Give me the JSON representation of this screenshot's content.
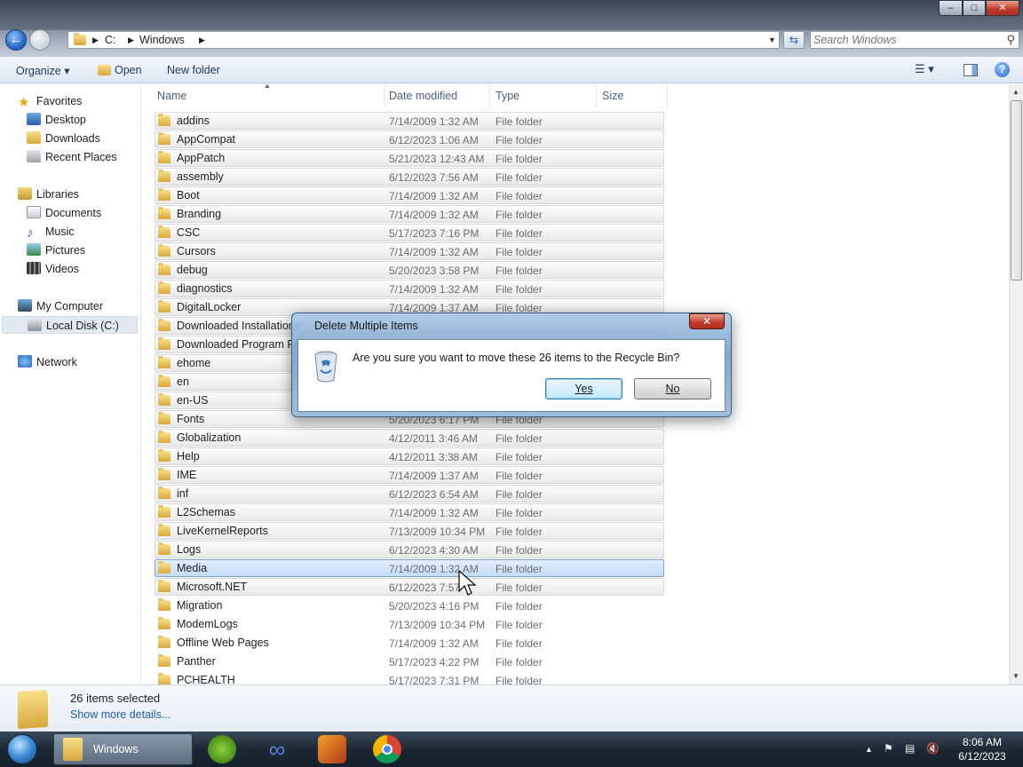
{
  "window": {
    "min_label": "–",
    "max_label": "□",
    "close_label": "✕"
  },
  "address": {
    "crumbs": [
      "C:",
      "Windows"
    ],
    "search_placeholder": "Search Windows"
  },
  "toolbar": {
    "organize": "Organize ▾",
    "open": "Open",
    "new_folder": "New folder"
  },
  "nav": {
    "favorites": "Favorites",
    "desktop": "Desktop",
    "downloads": "Downloads",
    "recent_places": "Recent Places",
    "libraries": "Libraries",
    "documents": "Documents",
    "music": "Music",
    "pictures": "Pictures",
    "videos": "Videos",
    "my_computer": "My Computer",
    "local_disk": "Local Disk (C:)",
    "network": "Network"
  },
  "columns": {
    "name": "Name",
    "date": "Date modified",
    "type": "Type",
    "size": "Size"
  },
  "rows": [
    {
      "name": "addins",
      "date": "7/14/2009 1:32 AM",
      "type": "File folder"
    },
    {
      "name": "AppCompat",
      "date": "6/12/2023 1:06 AM",
      "type": "File folder"
    },
    {
      "name": "AppPatch",
      "date": "5/21/2023 12:43 AM",
      "type": "File folder"
    },
    {
      "name": "assembly",
      "date": "6/12/2023 7:56 AM",
      "type": "File folder"
    },
    {
      "name": "Boot",
      "date": "7/14/2009 1:32 AM",
      "type": "File folder"
    },
    {
      "name": "Branding",
      "date": "7/14/2009 1:32 AM",
      "type": "File folder"
    },
    {
      "name": "CSC",
      "date": "5/17/2023 7:16 PM",
      "type": "File folder"
    },
    {
      "name": "Cursors",
      "date": "7/14/2009 1:32 AM",
      "type": "File folder"
    },
    {
      "name": "debug",
      "date": "5/20/2023 3:58 PM",
      "type": "File folder"
    },
    {
      "name": "diagnostics",
      "date": "7/14/2009 1:32 AM",
      "type": "File folder"
    },
    {
      "name": "DigitalLocker",
      "date": "7/14/2009 1:37 AM",
      "type": "File folder"
    },
    {
      "name": "Downloaded Installations",
      "date": "",
      "type": ""
    },
    {
      "name": "Downloaded Program Files",
      "date": "",
      "type": ""
    },
    {
      "name": "ehome",
      "date": "",
      "type": ""
    },
    {
      "name": "en",
      "date": "",
      "type": ""
    },
    {
      "name": "en-US",
      "date": "",
      "type": ""
    },
    {
      "name": "Fonts",
      "date": "5/20/2023 6:17 PM",
      "type": "File folder"
    },
    {
      "name": "Globalization",
      "date": "4/12/2011 3:46 AM",
      "type": "File folder"
    },
    {
      "name": "Help",
      "date": "4/12/2011 3:38 AM",
      "type": "File folder"
    },
    {
      "name": "IME",
      "date": "7/14/2009 1:37 AM",
      "type": "File folder"
    },
    {
      "name": "inf",
      "date": "6/12/2023 6:54 AM",
      "type": "File folder"
    },
    {
      "name": "L2Schemas",
      "date": "7/14/2009 1:32 AM",
      "type": "File folder"
    },
    {
      "name": "LiveKernelReports",
      "date": "7/13/2009 10:34 PM",
      "type": "File folder"
    },
    {
      "name": "Logs",
      "date": "6/12/2023 4:30 AM",
      "type": "File folder"
    },
    {
      "name": "Media",
      "date": "7/14/2009 1:32 AM",
      "type": "File folder"
    },
    {
      "name": "Microsoft.NET",
      "date": "6/12/2023 7:57",
      "type": "File folder"
    },
    {
      "name": "Migration",
      "date": "5/20/2023 4:16 PM",
      "type": "File folder"
    },
    {
      "name": "ModemLogs",
      "date": "7/13/2009 10:34 PM",
      "type": "File folder"
    },
    {
      "name": "Offline Web Pages",
      "date": "7/14/2009 1:32 AM",
      "type": "File folder"
    },
    {
      "name": "Panther",
      "date": "5/17/2023 4:22 PM",
      "type": "File folder"
    },
    {
      "name": "PCHEALTH",
      "date": "5/17/2023 7:31 PM",
      "type": "File folder"
    }
  ],
  "details": {
    "selected": "26 items selected",
    "more": "Show more details..."
  },
  "dialog": {
    "title": "Delete Multiple Items",
    "close": "✕",
    "message": "Are you sure you want to move these 26 items to the Recycle Bin?",
    "yes": "Yes",
    "no": "No"
  },
  "taskbar": {
    "explorer_label": "Windows",
    "time": "8:06 AM",
    "date": "6/12/2023"
  }
}
